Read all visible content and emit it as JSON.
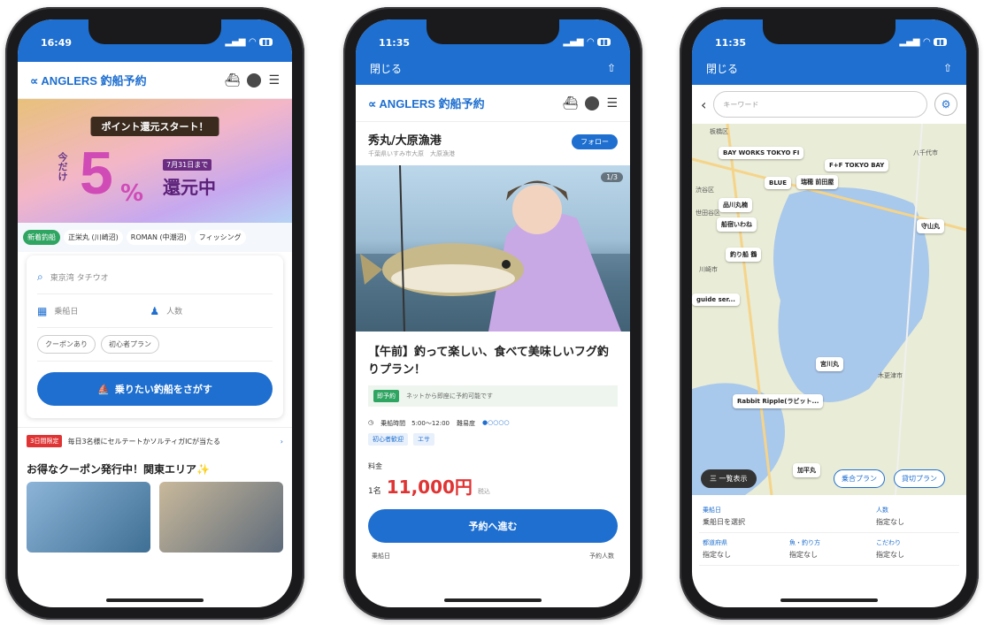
{
  "phone1": {
    "time": "16:49",
    "logo": "∝ ANGLERS 釣船予約",
    "banner": {
      "ribbon": "ポイント還元スタート！",
      "kondake": "今だけ",
      "big": "5",
      "pct": "%",
      "until": "7月31日まで",
      "kangen": "還元中"
    },
    "chips": [
      "新着釣船",
      "正栄丸 (川崎沼)",
      "ROMAN (中潮沼)",
      "フィッシング"
    ],
    "search": {
      "keyword_placeholder": "東京湾 タチウオ",
      "date_placeholder": "乗船日",
      "people_placeholder": "人数",
      "pill1": "クーポンあり",
      "pill2": "初心者プラン",
      "button": "乗りたい釣船をさがす"
    },
    "notice": {
      "badge": "3日間限定",
      "text": "毎日3名様にセルテートかソルティガICが当たる"
    },
    "section_title": "お得なクーポン発行中！関東エリア✨"
  },
  "phone2": {
    "time": "11:35",
    "close": "閉じる",
    "logo": "∝ ANGLERS 釣船予約",
    "shop_name": "秀丸/大原漁港",
    "shop_sub": "千葉県いすみ市大原　大原漁港",
    "follow": "フォロー",
    "photo_counter": "1/3",
    "plan_title": "【午前】釣って楽しい、食べて美味しいフグ釣りプラン！",
    "tag_label": "即予約",
    "tag_text": "ネットから即座に予約可能です",
    "time_row": "乗船時間　5:00〜12:00",
    "difficulty_label": "難易度",
    "difficulty": "●○○○○",
    "small_tags": [
      "初心者歓迎",
      "エサ"
    ],
    "price_label": "料金",
    "per": "1名",
    "price": "11,000円",
    "tax": "税込",
    "reserve": "予約へ進む",
    "bottom_left": "乗船日",
    "bottom_right": "予約人数"
  },
  "phone3": {
    "time": "11:35",
    "close": "閉じる",
    "search_placeholder": "キーワード",
    "map_labels": [
      "BAY WORKS TOKYO FI",
      "F+F TOKYO BAY",
      "BLUE",
      "瑞穂 前田屋",
      "品川丸楠",
      "船宿いわね",
      "釣り船 鶴",
      "Rabbit Ripple(ラビット...",
      "宮川丸",
      "加平丸",
      "守山丸",
      "guide ser..."
    ],
    "areas": [
      "板橋区",
      "八千代市",
      "渋谷区",
      "世田谷区",
      "川崎市",
      "木更津市"
    ],
    "list_toggle": "三 一覧表示",
    "plan_btn1": "乗合プラン",
    "plan_btn2": "貸切プラン",
    "filters": [
      {
        "k": "乗船日",
        "v": "乗船日を選択"
      },
      {
        "k": "人数",
        "v": "指定なし"
      },
      {
        "k": "都道府県",
        "v": "指定なし"
      },
      {
        "k": "魚・釣り方",
        "v": "指定なし"
      },
      {
        "k": "こだわり",
        "v": "指定なし"
      },
      {
        "k": "",
        "v": ""
      }
    ]
  }
}
